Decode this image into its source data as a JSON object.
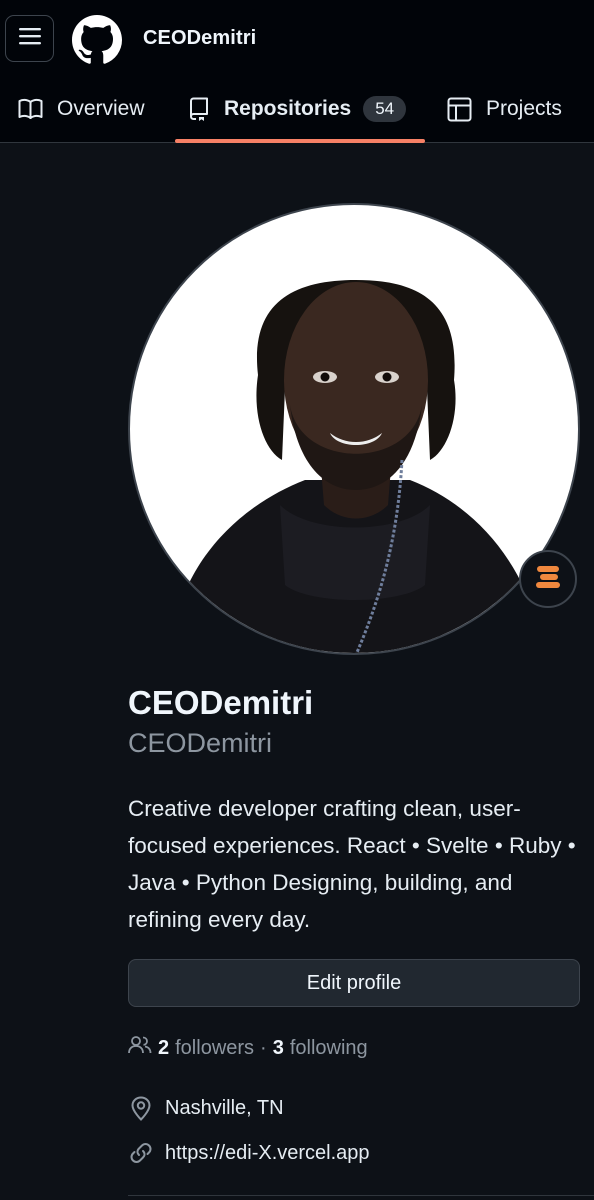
{
  "header": {
    "username": "CEODemitri"
  },
  "tabs": {
    "overview": "Overview",
    "repositories": "Repositories",
    "repositories_count": "54",
    "projects": "Projects"
  },
  "profile": {
    "name": "CEODemitri",
    "login": "CEODemitri",
    "bio": "Creative developer crafting clean, user-focused experiences. React • Svelte • Ruby • Java • Python Designing, building, and refining every day.",
    "edit_label": "Edit profile",
    "followers_count": "2",
    "followers_label": "followers",
    "separator": "·",
    "following_count": "3",
    "following_label": "following",
    "location": "Nashville, TN",
    "website": "https://edi-X.vercel.app"
  },
  "colors": {
    "background": "#0d1117",
    "header_background": "#010409",
    "active_tab_underline": "#f78166",
    "muted_text": "#8d96a0",
    "status_emoji": "#f0883e"
  },
  "icons": {
    "menu": "hamburger-icon",
    "logo": "github-mark-icon",
    "overview": "book-icon",
    "repositories": "repo-icon",
    "projects": "table-icon",
    "status": "stacked-bars-emoji-icon",
    "followers": "people-icon",
    "location": "location-pin-icon",
    "website": "link-icon"
  }
}
